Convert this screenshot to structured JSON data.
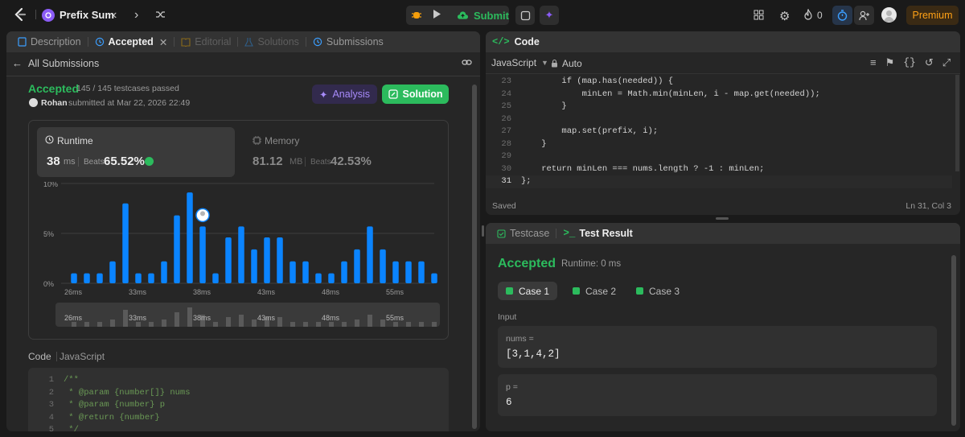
{
  "topbar": {
    "problem_title": "Prefix Sum",
    "submit_label": "Submit",
    "streak_count": "0",
    "premium_label": "Premium"
  },
  "left": {
    "tabs": [
      {
        "label": "Description"
      },
      {
        "label": "Accepted"
      },
      {
        "label": "Editorial"
      },
      {
        "label": "Solutions"
      },
      {
        "label": "Submissions"
      }
    ],
    "back_label": "All Submissions",
    "status": "Accepted",
    "testcases": "145 / 145 testcases passed",
    "user": "Rohan",
    "submitted_text": "submitted at Mar 22, 2026 22:49",
    "analysis_label": "Analysis",
    "solution_label": "Solution",
    "runtime": {
      "label": "Runtime",
      "value": "38",
      "unit": "ms",
      "beats_label": "Beats",
      "beats_value": "65.52%"
    },
    "memory": {
      "label": "Memory",
      "value": "81.12",
      "unit": "MB",
      "beats_label": "Beats",
      "beats_value": "42.53%"
    },
    "code_label": "Code",
    "code_lang": "JavaScript",
    "code_lines": [
      {
        "n": "1",
        "t": "/**"
      },
      {
        "n": "2",
        "t": " * @param {number[]} nums"
      },
      {
        "n": "3",
        "t": " * @param {number} p"
      },
      {
        "n": "4",
        "t": " * @return {number}"
      },
      {
        "n": "5",
        "t": " */"
      }
    ]
  },
  "chart_data": {
    "type": "bar",
    "ylim": [
      0,
      10
    ],
    "yticks": [
      "10%",
      "5%",
      "0%"
    ],
    "xticks": [
      "26ms",
      "33ms",
      "38ms",
      "43ms",
      "48ms",
      "55ms"
    ],
    "values": [
      1.0,
      1.0,
      1.0,
      2.2,
      8.0,
      1.0,
      1.0,
      2.2,
      6.8,
      9.1,
      5.7,
      1.0,
      4.6,
      5.7,
      3.4,
      4.6,
      4.6,
      2.2,
      2.2,
      1.0,
      1.0,
      2.2,
      3.4,
      5.7,
      3.4,
      2.2,
      2.2,
      2.2,
      1.0
    ],
    "highlight_label": "38ms",
    "minimap_values": [
      1,
      1,
      1,
      1.5,
      3.5,
      1,
      1,
      1.5,
      3,
      4,
      2.5,
      1,
      2,
      2.5,
      1.5,
      2,
      2,
      1,
      1,
      1,
      1,
      1,
      1.5,
      2.5,
      1.5,
      1,
      1,
      1,
      1
    ],
    "colors": {
      "bar": "#0a84ff",
      "minimap": "#5a5a5a",
      "grid": "#3d3d3d"
    }
  },
  "right_code": {
    "title": "Code",
    "language": "JavaScript",
    "auto_label": "Auto",
    "saved_label": "Saved",
    "cursor_pos": "Ln 31, Col 3",
    "lines": [
      {
        "n": "23",
        "t": "        if (map.has(needed)) {"
      },
      {
        "n": "24",
        "t": "            minLen = Math.min(minLen, i - map.get(needed));"
      },
      {
        "n": "25",
        "t": "        }"
      },
      {
        "n": "26",
        "t": ""
      },
      {
        "n": "27",
        "t": "        map.set(prefix, i);"
      },
      {
        "n": "28",
        "t": "    }"
      },
      {
        "n": "29",
        "t": ""
      },
      {
        "n": "30",
        "t": "    return minLen === nums.length ? -1 : minLen;"
      },
      {
        "n": "31",
        "t": "};"
      }
    ]
  },
  "test": {
    "tabs": [
      {
        "label": "Testcase"
      },
      {
        "label": "Test Result"
      }
    ],
    "status": "Accepted",
    "runtime_text": "Runtime: 0 ms",
    "cases": [
      {
        "label": "Case 1"
      },
      {
        "label": "Case 2"
      },
      {
        "label": "Case 3"
      }
    ],
    "input_label": "Input",
    "params": [
      {
        "name": "nums =",
        "value": "[3,1,4,2]"
      },
      {
        "name": "p =",
        "value": "6"
      }
    ]
  }
}
